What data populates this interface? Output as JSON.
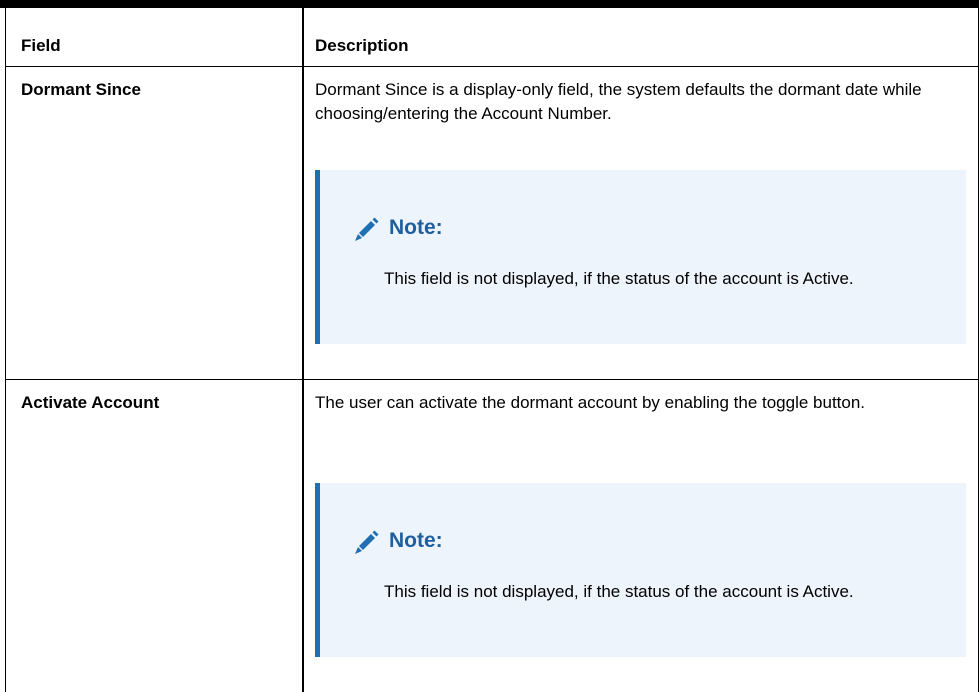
{
  "table": {
    "header": {
      "field": "Field",
      "description": "Description"
    },
    "rows": [
      {
        "field": "Dormant Since",
        "description": "Dormant Since is a display-only field, the system defaults the dormant date while choosing/entering the Account Number.",
        "note": {
          "icon": "pencil-icon",
          "title": "Note:",
          "body": "This field is not displayed, if the status of the account is Active."
        }
      },
      {
        "field": "Activate Account",
        "description": "The user can activate the dormant account by enabling the toggle button.",
        "note": {
          "icon": "pencil-icon",
          "title": "Note:",
          "body": "This field is not displayed, if the status of the account is Active."
        }
      }
    ]
  },
  "colors": {
    "note_accent": "#1f6fb2",
    "note_title": "#1f5f9f",
    "note_background": "#eef4fb"
  }
}
